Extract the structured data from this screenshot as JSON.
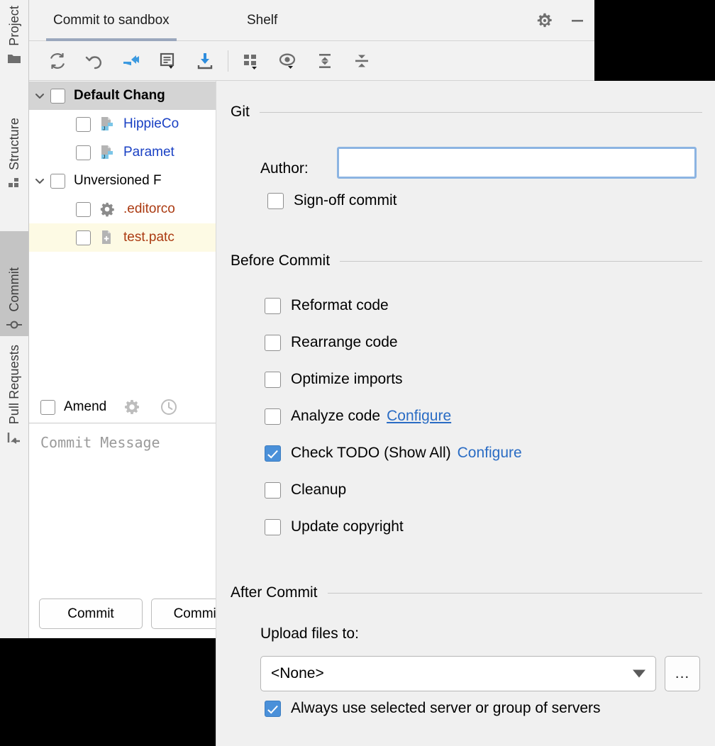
{
  "window": {
    "tabs": [
      {
        "label": "Commit to sandbox",
        "active": true
      },
      {
        "label": "Shelf",
        "active": false
      }
    ],
    "actions": [
      {
        "name": "gear-icon",
        "label": "Settings"
      },
      {
        "name": "minimize-icon",
        "label": "Hide"
      }
    ]
  },
  "toolbar": {
    "buttons": [
      {
        "name": "refresh-icon",
        "label": "Refresh Changes"
      },
      {
        "name": "rollback-icon",
        "label": "Rollback"
      },
      {
        "name": "diff-icon",
        "label": "Show Diff"
      },
      {
        "name": "commit-message-icon",
        "label": "Commit Message History"
      },
      {
        "name": "update-project-icon",
        "label": "Update Project"
      },
      {
        "name": "group-by-icon",
        "label": "Group By"
      },
      {
        "name": "preview-diff-icon",
        "label": "Preview Diff"
      },
      {
        "name": "expand-all-icon",
        "label": "Expand All"
      },
      {
        "name": "collapse-all-icon",
        "label": "Collapse All"
      }
    ]
  },
  "changes_tree": {
    "rows": [
      {
        "label": "Default Chang",
        "indent": 0,
        "twisty": "down",
        "checked": false,
        "style": "bold",
        "icon": "none",
        "row_state": "selected"
      },
      {
        "label": "HippieCo",
        "indent": 1,
        "twisty": "none",
        "checked": false,
        "style": "blue",
        "icon": "java-file-icon",
        "row_state": "normal"
      },
      {
        "label": "Paramet",
        "indent": 1,
        "twisty": "none",
        "checked": false,
        "style": "blue",
        "icon": "java-file-icon",
        "row_state": "normal"
      },
      {
        "label": "Unversioned F",
        "indent": 0,
        "twisty": "down",
        "checked": false,
        "style": "normal",
        "icon": "none",
        "row_state": "normal"
      },
      {
        "label": ".editorco",
        "indent": 1,
        "twisty": "none",
        "checked": false,
        "style": "red",
        "icon": "gear-file-icon",
        "row_state": "normal"
      },
      {
        "label": "test.patc",
        "indent": 1,
        "twisty": "none",
        "checked": false,
        "style": "red",
        "icon": "patch-file-icon",
        "row_state": "highlighted"
      }
    ]
  },
  "amend": {
    "label": "Amend",
    "checked": false,
    "icons": [
      {
        "name": "gear-icon",
        "label": "Commit Options"
      },
      {
        "name": "history-icon",
        "label": "Commit Message History"
      }
    ]
  },
  "commit_message": {
    "placeholder": "Commit Message",
    "value": ""
  },
  "commit_buttons": [
    {
      "label": "Commit"
    },
    {
      "label": "Commit and Push..."
    }
  ],
  "sidebar": {
    "items": [
      {
        "label": "Project",
        "icon": "folder-icon",
        "selected": false
      },
      {
        "label": "Structure",
        "icon": "structure-icon",
        "selected": false
      },
      {
        "label": "Commit",
        "icon": "commit-node-icon",
        "selected": true
      },
      {
        "label": "Pull Requests",
        "icon": "pull-request-icon",
        "selected": false
      }
    ]
  },
  "options_panel": {
    "git": {
      "title": "Git",
      "author_label": "Author:",
      "author_value": "",
      "author_placeholder": "",
      "signoff": {
        "label": "Sign-off commit",
        "checked": false
      }
    },
    "before_commit": {
      "title": "Before Commit",
      "items": [
        {
          "label": "Reformat code",
          "checked": false,
          "link": ""
        },
        {
          "label": "Rearrange code",
          "checked": false,
          "link": ""
        },
        {
          "label": "Optimize imports",
          "checked": false,
          "link": ""
        },
        {
          "label": "Analyze code",
          "checked": false,
          "link": "Configure",
          "link_underline": true
        },
        {
          "label": "Check TODO (Show All)",
          "checked": true,
          "link": "Configure",
          "link_underline": false
        },
        {
          "label": "Cleanup",
          "checked": false,
          "link": ""
        },
        {
          "label": "Update copyright",
          "checked": false,
          "link": ""
        }
      ]
    },
    "after_commit": {
      "title": "After Commit",
      "upload_label": "Upload files to:",
      "server_value": "<None>",
      "dots_label": "...",
      "always_use": {
        "label": "Always use selected server or group of servers",
        "checked": true
      }
    }
  },
  "colors": {
    "accent_checked": "#4a90d9",
    "link": "#2a6cc4",
    "tab_underline": "#9aa7bd",
    "focus_border": "#8cb4e2",
    "panel_bg": "#f0f0f0",
    "window_bg": "#f2f2f2",
    "selected_row": "#d4d4d4",
    "highlight_row": "#fdfae4",
    "file_blue": "#1a41c4",
    "file_red": "#ab3b12"
  }
}
